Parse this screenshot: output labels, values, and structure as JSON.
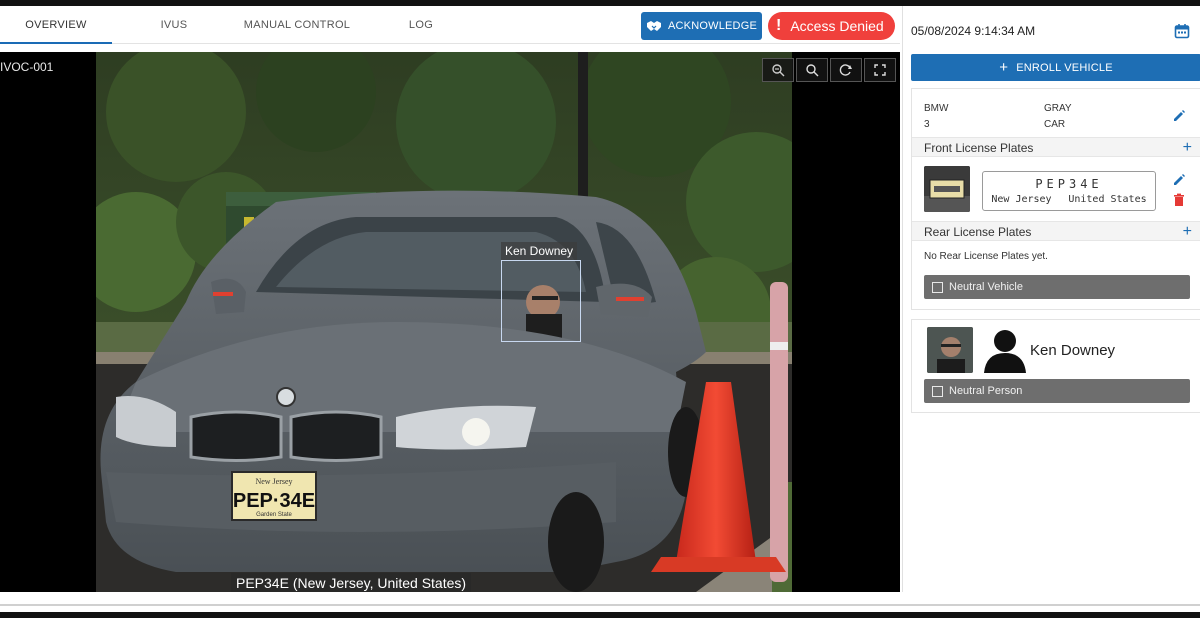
{
  "tabs": [
    {
      "label": "OVERVIEW",
      "active": true
    },
    {
      "label": "IVUS",
      "active": false
    },
    {
      "label": "MANUAL CONTROL",
      "active": false
    },
    {
      "label": "LOG",
      "active": false
    }
  ],
  "actions": {
    "acknowledge_label": "ACKNOWLEDGE",
    "status_label": "Access Denied",
    "status_icon": "exclamation-icon"
  },
  "video": {
    "camera_label": "IVOC-001",
    "face_label": "Ken Downey",
    "plate_label": "PEP34E (New Jersey, United States)",
    "plate_text": "PEP·34E",
    "plate_state": "New Jersey",
    "plate_motto": "Garden State",
    "tools": [
      "zoom-out-icon",
      "zoom-in-icon",
      "reset-icon",
      "fullscreen-icon"
    ]
  },
  "panel": {
    "datetime": "05/08/2024 9:14:34 AM",
    "enroll_label": "ENROLL VEHICLE",
    "vehicle": {
      "make": "BMW",
      "model": "3",
      "color": "GRAY",
      "type": "CAR"
    },
    "front_plates_title": "Front License Plates",
    "front_plate": {
      "number": "PEP34E",
      "state": "New Jersey",
      "country": "United States"
    },
    "rear_plates_title": "Rear License Plates",
    "rear_empty": "No Rear License Plates yet.",
    "neutral_vehicle_label": "Neutral Vehicle",
    "person": {
      "name": "Ken Downey",
      "neutral_label": "Neutral Person"
    }
  },
  "colors": {
    "primary": "#1e6eb4",
    "danger": "#f0403c",
    "neutral_bar": "#6e6e6e",
    "delete": "#e53935"
  }
}
